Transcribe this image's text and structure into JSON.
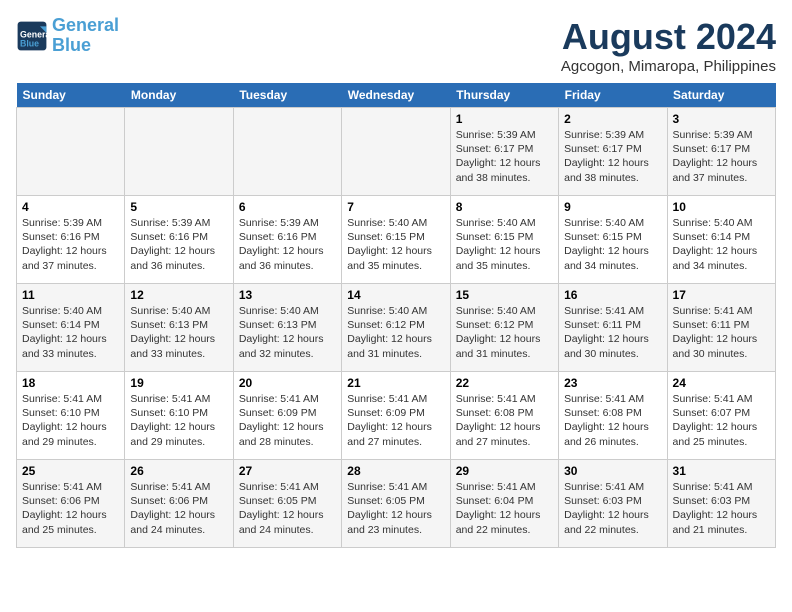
{
  "header": {
    "logo_line1": "General",
    "logo_line2": "Blue",
    "month_year": "August 2024",
    "location": "Agcogon, Mimaropa, Philippines"
  },
  "days_of_week": [
    "Sunday",
    "Monday",
    "Tuesday",
    "Wednesday",
    "Thursday",
    "Friday",
    "Saturday"
  ],
  "weeks": [
    [
      {
        "day": "",
        "info": ""
      },
      {
        "day": "",
        "info": ""
      },
      {
        "day": "",
        "info": ""
      },
      {
        "day": "",
        "info": ""
      },
      {
        "day": "1",
        "info": "Sunrise: 5:39 AM\nSunset: 6:17 PM\nDaylight: 12 hours\nand 38 minutes."
      },
      {
        "day": "2",
        "info": "Sunrise: 5:39 AM\nSunset: 6:17 PM\nDaylight: 12 hours\nand 38 minutes."
      },
      {
        "day": "3",
        "info": "Sunrise: 5:39 AM\nSunset: 6:17 PM\nDaylight: 12 hours\nand 37 minutes."
      }
    ],
    [
      {
        "day": "4",
        "info": "Sunrise: 5:39 AM\nSunset: 6:16 PM\nDaylight: 12 hours\nand 37 minutes."
      },
      {
        "day": "5",
        "info": "Sunrise: 5:39 AM\nSunset: 6:16 PM\nDaylight: 12 hours\nand 36 minutes."
      },
      {
        "day": "6",
        "info": "Sunrise: 5:39 AM\nSunset: 6:16 PM\nDaylight: 12 hours\nand 36 minutes."
      },
      {
        "day": "7",
        "info": "Sunrise: 5:40 AM\nSunset: 6:15 PM\nDaylight: 12 hours\nand 35 minutes."
      },
      {
        "day": "8",
        "info": "Sunrise: 5:40 AM\nSunset: 6:15 PM\nDaylight: 12 hours\nand 35 minutes."
      },
      {
        "day": "9",
        "info": "Sunrise: 5:40 AM\nSunset: 6:15 PM\nDaylight: 12 hours\nand 34 minutes."
      },
      {
        "day": "10",
        "info": "Sunrise: 5:40 AM\nSunset: 6:14 PM\nDaylight: 12 hours\nand 34 minutes."
      }
    ],
    [
      {
        "day": "11",
        "info": "Sunrise: 5:40 AM\nSunset: 6:14 PM\nDaylight: 12 hours\nand 33 minutes."
      },
      {
        "day": "12",
        "info": "Sunrise: 5:40 AM\nSunset: 6:13 PM\nDaylight: 12 hours\nand 33 minutes."
      },
      {
        "day": "13",
        "info": "Sunrise: 5:40 AM\nSunset: 6:13 PM\nDaylight: 12 hours\nand 32 minutes."
      },
      {
        "day": "14",
        "info": "Sunrise: 5:40 AM\nSunset: 6:12 PM\nDaylight: 12 hours\nand 31 minutes."
      },
      {
        "day": "15",
        "info": "Sunrise: 5:40 AM\nSunset: 6:12 PM\nDaylight: 12 hours\nand 31 minutes."
      },
      {
        "day": "16",
        "info": "Sunrise: 5:41 AM\nSunset: 6:11 PM\nDaylight: 12 hours\nand 30 minutes."
      },
      {
        "day": "17",
        "info": "Sunrise: 5:41 AM\nSunset: 6:11 PM\nDaylight: 12 hours\nand 30 minutes."
      }
    ],
    [
      {
        "day": "18",
        "info": "Sunrise: 5:41 AM\nSunset: 6:10 PM\nDaylight: 12 hours\nand 29 minutes."
      },
      {
        "day": "19",
        "info": "Sunrise: 5:41 AM\nSunset: 6:10 PM\nDaylight: 12 hours\nand 29 minutes."
      },
      {
        "day": "20",
        "info": "Sunrise: 5:41 AM\nSunset: 6:09 PM\nDaylight: 12 hours\nand 28 minutes."
      },
      {
        "day": "21",
        "info": "Sunrise: 5:41 AM\nSunset: 6:09 PM\nDaylight: 12 hours\nand 27 minutes."
      },
      {
        "day": "22",
        "info": "Sunrise: 5:41 AM\nSunset: 6:08 PM\nDaylight: 12 hours\nand 27 minutes."
      },
      {
        "day": "23",
        "info": "Sunrise: 5:41 AM\nSunset: 6:08 PM\nDaylight: 12 hours\nand 26 minutes."
      },
      {
        "day": "24",
        "info": "Sunrise: 5:41 AM\nSunset: 6:07 PM\nDaylight: 12 hours\nand 25 minutes."
      }
    ],
    [
      {
        "day": "25",
        "info": "Sunrise: 5:41 AM\nSunset: 6:06 PM\nDaylight: 12 hours\nand 25 minutes."
      },
      {
        "day": "26",
        "info": "Sunrise: 5:41 AM\nSunset: 6:06 PM\nDaylight: 12 hours\nand 24 minutes."
      },
      {
        "day": "27",
        "info": "Sunrise: 5:41 AM\nSunset: 6:05 PM\nDaylight: 12 hours\nand 24 minutes."
      },
      {
        "day": "28",
        "info": "Sunrise: 5:41 AM\nSunset: 6:05 PM\nDaylight: 12 hours\nand 23 minutes."
      },
      {
        "day": "29",
        "info": "Sunrise: 5:41 AM\nSunset: 6:04 PM\nDaylight: 12 hours\nand 22 minutes."
      },
      {
        "day": "30",
        "info": "Sunrise: 5:41 AM\nSunset: 6:03 PM\nDaylight: 12 hours\nand 22 minutes."
      },
      {
        "day": "31",
        "info": "Sunrise: 5:41 AM\nSunset: 6:03 PM\nDaylight: 12 hours\nand 21 minutes."
      }
    ]
  ]
}
